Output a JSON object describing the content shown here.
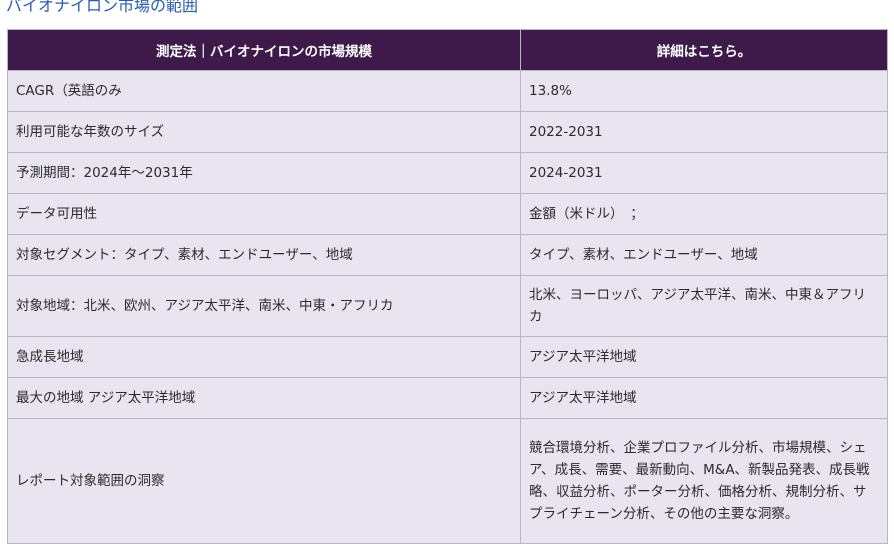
{
  "page_title": "バイオナイロン市場の範囲",
  "table": {
    "headers": [
      "測定法｜バイオナイロンの市場規模",
      "詳細はこちら。"
    ],
    "rows": [
      {
        "label": "CAGR（英語のみ",
        "value": "13.8%"
      },
      {
        "label": "利用可能な年数のサイズ",
        "value": "2022-2031"
      },
      {
        "label": "予測期間：2024年～2031年",
        "value": "2024-2031"
      },
      {
        "label": "データ可用性",
        "value": "金額（米ドル）　；"
      },
      {
        "label": "対象セグメント：タイプ、素材、エンドユーザー、地域",
        "value": "タイプ、素材、エンドユーザー、地域"
      },
      {
        "label": "対象地域：北米、欧州、アジア太平洋、南米、中東・アフリカ",
        "value": "北米、ヨーロッパ、アジア太平洋、南米、中東＆アフリカ"
      },
      {
        "label": "急成長地域",
        "value": "アジア太平洋地域"
      },
      {
        "label": "最大の地域 アジア太平洋地域",
        "value": "アジア太平洋地域"
      },
      {
        "label": "レポート対象範囲の洞察",
        "value": "競合環境分析、企業プロファイル分析、市場規模、シェア、成長、需要、最新動向、M&A、新製品発表、成長戦略、収益分析、ポーター分析、価格分析、規制分析、サプライチェーン分析、その他の主要な洞察。"
      }
    ]
  }
}
